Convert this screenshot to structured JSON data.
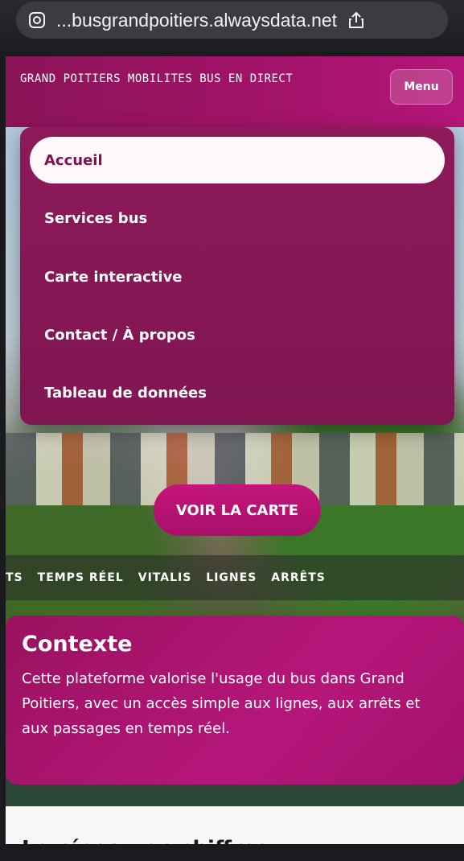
{
  "browser": {
    "url": "...busgrandpoitiers.alwaysdata.net"
  },
  "header": {
    "brand": "GRAND POITIERS MOBILITES BUS EN DIRECT",
    "menu_label": "Menu"
  },
  "dropdown": {
    "items": [
      {
        "label": "Accueil",
        "active": true
      },
      {
        "label": "Services bus",
        "active": false
      },
      {
        "label": "Carte interactive",
        "active": false
      },
      {
        "label": "Contact / À propos",
        "active": false
      },
      {
        "label": "Tableau de données",
        "active": false
      }
    ]
  },
  "hero": {
    "cta_label": "VOIR LA CARTE"
  },
  "ticker": {
    "items": [
      "TS",
      "TEMPS RÉEL",
      "VITALIS",
      "LIGNES",
      "ARRÊTS"
    ]
  },
  "context": {
    "title": "Contexte",
    "text": "Cette plateforme valorise l'usage du bus dans Grand Poitiers, avec un accès simple aux lignes, aux arrêts et aux passages en temps réel."
  },
  "bottom": {
    "heading": "Le réseau en chiffres"
  },
  "colors": {
    "brand": "#a3136a",
    "dropdown_bg": "#8d1a5b",
    "cta": "#c5157c"
  }
}
